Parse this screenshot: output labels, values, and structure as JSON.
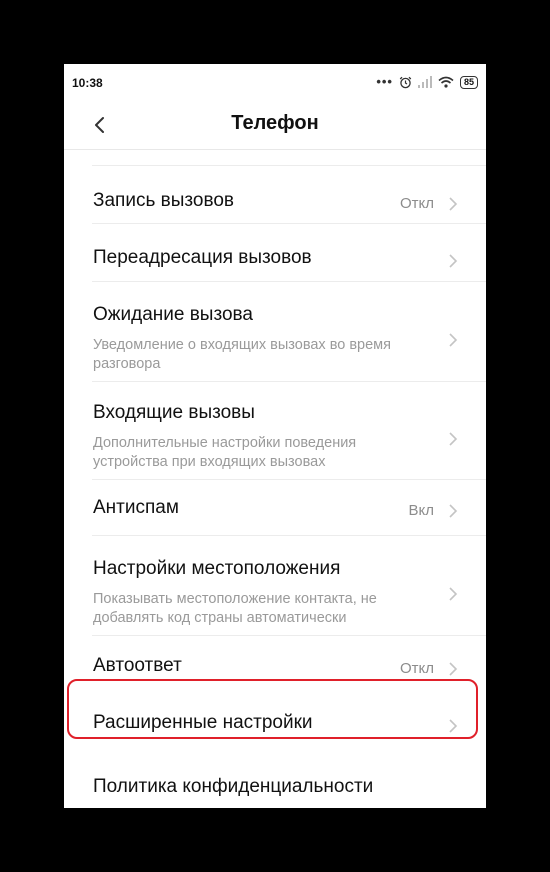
{
  "status_bar": {
    "time": "10:38",
    "battery": "85",
    "icons": [
      "dots-icon",
      "alarm-icon",
      "signal-icon",
      "wifi-icon",
      "battery-icon"
    ]
  },
  "header": {
    "title": "Телефон",
    "back_icon": "chevron-left-icon"
  },
  "settings": [
    {
      "label": "Запись вызовов",
      "value": "Откл"
    },
    {
      "label": "Переадресация вызовов"
    },
    {
      "label": "Ожидание вызова",
      "description": "Уведомление о входящих вызовах во время разговора"
    },
    {
      "label": "Входящие вызовы",
      "description": "Дополнительные настройки поведения устройства при входящих вызовах"
    },
    {
      "label": "Антиспам",
      "value": "Вкл"
    },
    {
      "label": "Настройки местоположения",
      "description": "Показывать местоположение контакта, не добавлять код страны автоматически"
    },
    {
      "label": "Автоответ",
      "value": "Откл"
    },
    {
      "label": "Расширенные настройки"
    },
    {
      "label": "Политика конфиденциальности"
    }
  ],
  "highlight_color": "#e0202a"
}
